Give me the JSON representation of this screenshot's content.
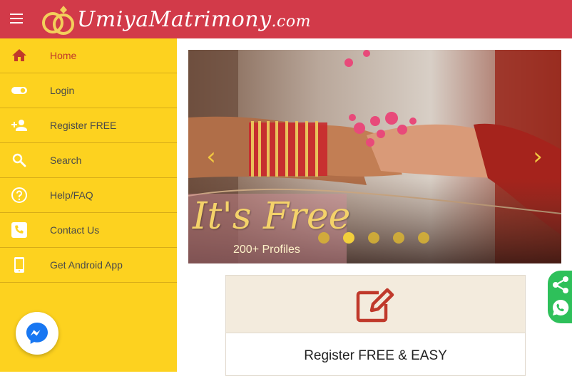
{
  "header": {
    "logo_main": "UmiyaMatrimony",
    "logo_domain": ".com",
    "brand_color": "#d23a49"
  },
  "sidebar": {
    "bg_color": "#fdd21f",
    "items": [
      {
        "label": "Home",
        "icon": "home-icon",
        "active": true
      },
      {
        "label": "Login",
        "icon": "toggle-icon"
      },
      {
        "label": "Register FREE",
        "icon": "person-add-icon"
      },
      {
        "label": "Search",
        "icon": "search-icon"
      },
      {
        "label": "Help/FAQ",
        "icon": "help-icon"
      },
      {
        "label": "Contact Us",
        "icon": "phone-icon"
      },
      {
        "label": "Get Android App",
        "icon": "mobile-icon"
      }
    ]
  },
  "slider": {
    "caption_title": "It's Free",
    "caption_sub": "200+ Profiles",
    "prev_icon": "chevron-left-icon",
    "next_icon": "chevron-right-icon",
    "dots_total": 5,
    "active_dot": 2
  },
  "register_card": {
    "title": "Register FREE & EASY",
    "icon": "edit-icon"
  },
  "floating": {
    "messenger_icon": "messenger-icon",
    "share_icon": "share-icon",
    "whatsapp_icon": "whatsapp-icon",
    "share_color": "#2ec05a"
  }
}
